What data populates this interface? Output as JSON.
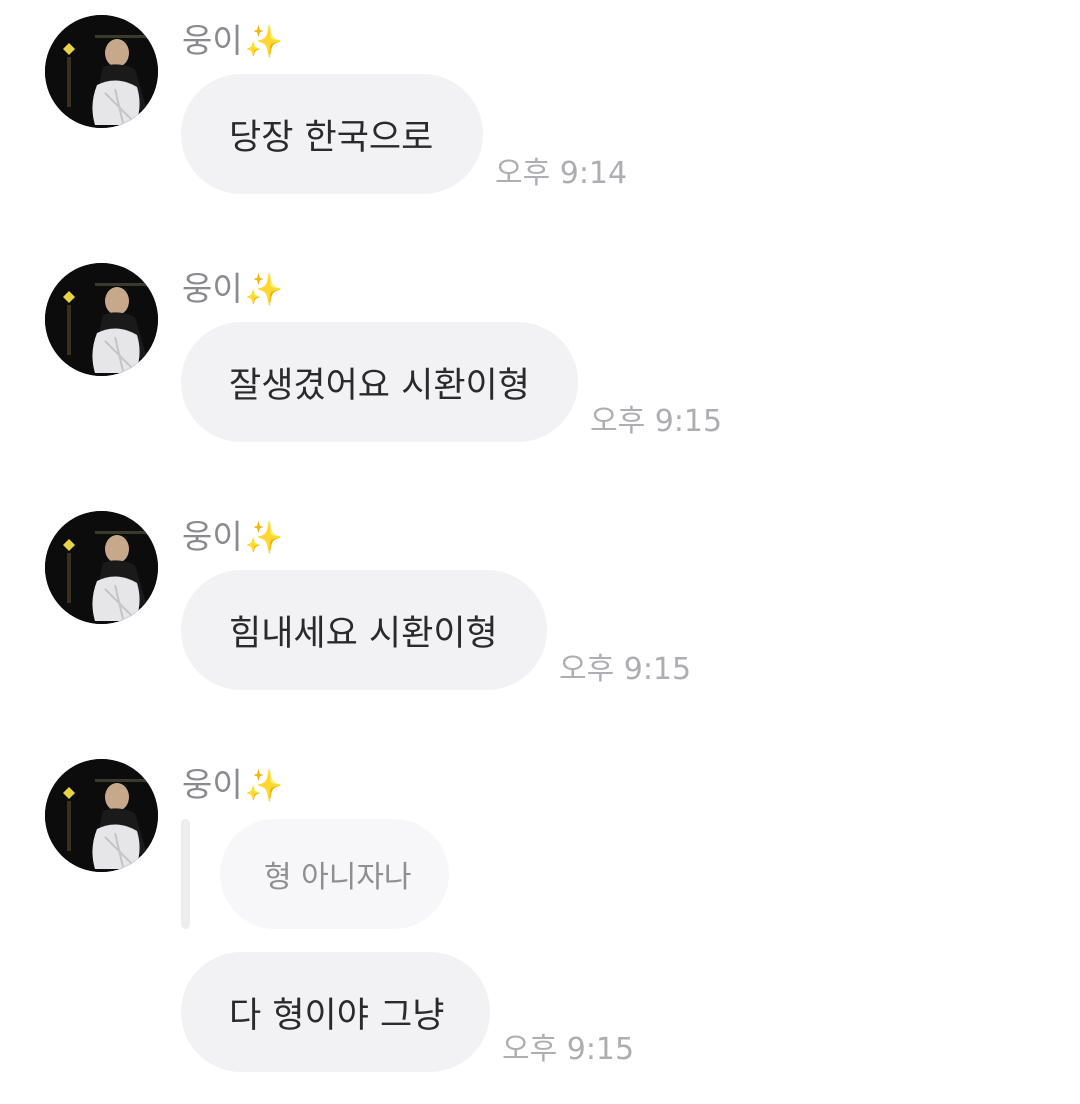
{
  "messages": [
    {
      "sender": "웅이",
      "sender_emoji": "✨",
      "text": "당장 한국으로",
      "time": "오후 9:14"
    },
    {
      "sender": "웅이",
      "sender_emoji": "✨",
      "text": "잘생겼어요 시환이형",
      "time": "오후 9:15"
    },
    {
      "sender": "웅이",
      "sender_emoji": "✨",
      "text": "힘내세요 시환이형",
      "time": "오후 9:15"
    },
    {
      "sender": "웅이",
      "sender_emoji": "✨",
      "reply_to": "형 아니자나",
      "text": "다 형이야 그냥",
      "time": "오후 9:15"
    }
  ],
  "colors": {
    "bubble_bg": "#f2f2f4",
    "reply_bg": "#f7f7f9",
    "sender_text": "#8a8a8e",
    "time_text": "#aeaeb2",
    "message_text": "#2a2a2c"
  },
  "icons": {
    "sparkle": "sparkles-emoji",
    "avatar": "profile-photo"
  }
}
